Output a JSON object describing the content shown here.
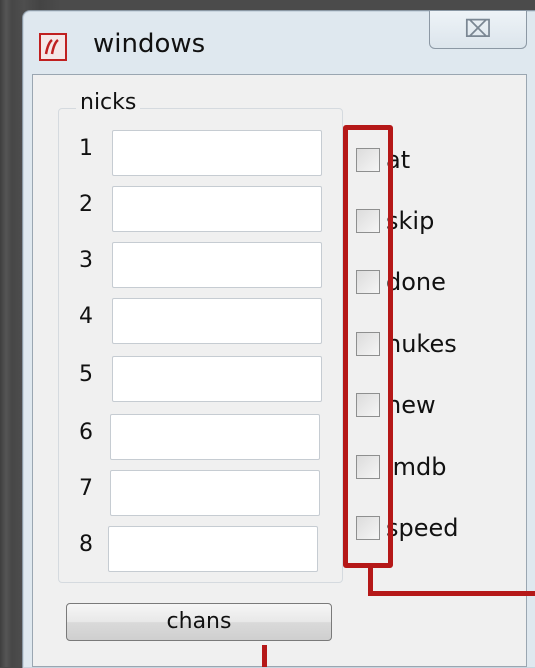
{
  "window": {
    "title": "windows",
    "close_glyph": "⌧"
  },
  "nicks": {
    "legend": "nicks",
    "rows": [
      {
        "num": "1",
        "value": ""
      },
      {
        "num": "2",
        "value": ""
      },
      {
        "num": "3",
        "value": ""
      },
      {
        "num": "4",
        "value": ""
      },
      {
        "num": "5",
        "value": ""
      },
      {
        "num": "6",
        "value": ""
      },
      {
        "num": "7",
        "value": ""
      },
      {
        "num": "8",
        "value": ""
      }
    ]
  },
  "options": [
    {
      "label": "at",
      "checked": false
    },
    {
      "label": "skip",
      "checked": false
    },
    {
      "label": "done",
      "checked": false
    },
    {
      "label": "nukes",
      "checked": false
    },
    {
      "label": "new",
      "checked": false
    },
    {
      "label": "imdb",
      "checked": false
    },
    {
      "label": "speed",
      "checked": false
    }
  ],
  "actions": {
    "chans_label": "chans"
  },
  "colors": {
    "highlight": "#b51818",
    "window_bg": "#dfe8ef",
    "client_bg": "#f0f0f0"
  }
}
